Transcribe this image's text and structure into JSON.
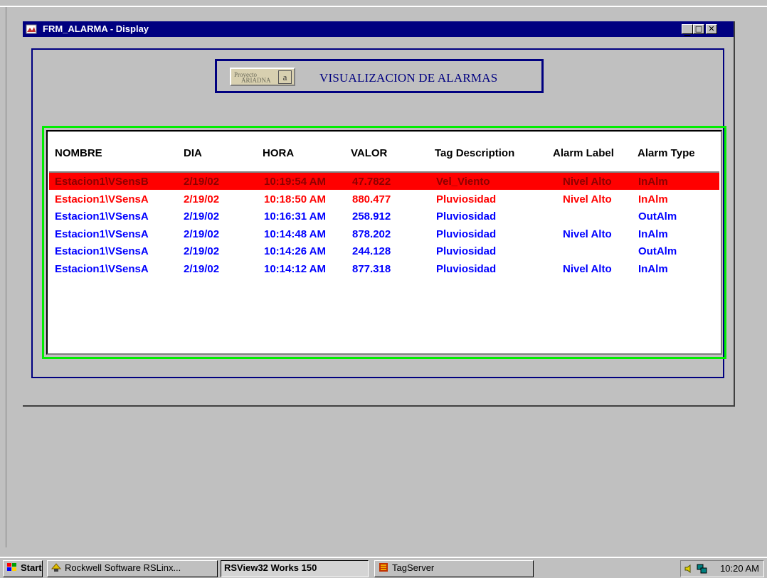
{
  "window": {
    "title": "FRM_ALARMA - Display",
    "minimize_label": "_",
    "maximize_label": "□",
    "close_label": "✕"
  },
  "header": {
    "logo_line1": "Proyecto",
    "logo_line2": "ARIADNA",
    "logo_mark": "a",
    "title": "VISUALIZACION DE ALARMAS"
  },
  "table": {
    "columns": [
      "NOMBRE",
      "DIA",
      "HORA",
      "VALOR",
      "Tag Description",
      "Alarm Label",
      "Alarm Type"
    ],
    "rows": [
      {
        "nombre": "Estacion1\\VSensB",
        "dia": "2/19/02",
        "hora": "10:19:54 AM",
        "valor": "47.7822",
        "desc": "Vel_Viento",
        "label": "Nivel Alto",
        "type": "InAlm",
        "color": "#ff0000",
        "selected": true
      },
      {
        "nombre": "Estacion1\\VSensA",
        "dia": "2/19/02",
        "hora": "10:18:50 AM",
        "valor": "880.477",
        "desc": "Pluviosidad",
        "label": "Nivel Alto",
        "type": "InAlm",
        "color": "#ff0000",
        "selected": false
      },
      {
        "nombre": "Estacion1\\VSensA",
        "dia": "2/19/02",
        "hora": "10:16:31 AM",
        "valor": "258.912",
        "desc": "Pluviosidad",
        "label": "",
        "type": "OutAlm",
        "color": "#0000ff",
        "selected": false
      },
      {
        "nombre": "Estacion1\\VSensA",
        "dia": "2/19/02",
        "hora": "10:14:48 AM",
        "valor": "878.202",
        "desc": "Pluviosidad",
        "label": "Nivel Alto",
        "type": "InAlm",
        "color": "#0000ff",
        "selected": false
      },
      {
        "nombre": "Estacion1\\VSensA",
        "dia": "2/19/02",
        "hora": "10:14:26 AM",
        "valor": "244.128",
        "desc": "Pluviosidad",
        "label": "",
        "type": "OutAlm",
        "color": "#0000ff",
        "selected": false
      },
      {
        "nombre": "Estacion1\\VSensA",
        "dia": "2/19/02",
        "hora": "10:14:12 AM",
        "valor": "877.318",
        "desc": "Pluviosidad",
        "label": "Nivel Alto",
        "type": "InAlm",
        "color": "#0000ff",
        "selected": false
      }
    ],
    "selected_fg": "#8b0000",
    "selected_bg": "#ff0000"
  },
  "taskbar": {
    "start_label": "Start",
    "items": [
      {
        "label": "Rockwell Software RSLinx...",
        "active": false,
        "icon": "rslinx-icon"
      },
      {
        "label": "RSView32 Works 150",
        "active": true,
        "icon": ""
      },
      {
        "label": "TagServer",
        "active": false,
        "icon": "tagserver-icon"
      }
    ],
    "clock": "10:20 AM"
  }
}
